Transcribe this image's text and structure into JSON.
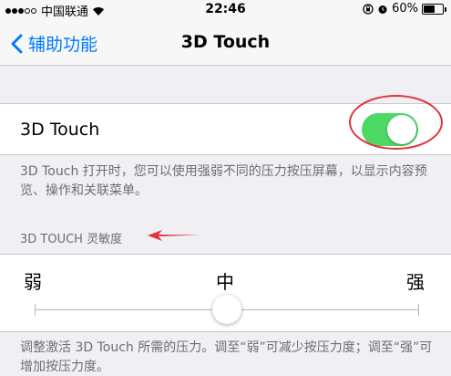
{
  "status_bar": {
    "carrier": "中国联通",
    "time": "22:46",
    "battery": "60%",
    "battery_level": 0.6,
    "signal_strength": 3,
    "signal_total": 5,
    "icons": [
      "signal-dots-icon",
      "wifi-icon",
      "orientation-lock-icon",
      "alarm-icon",
      "battery-icon"
    ]
  },
  "nav": {
    "back_label": "辅助功能",
    "title": "3D Touch"
  },
  "toggle_row": {
    "label": "3D Touch",
    "enabled": true,
    "on_color": "#4cd964"
  },
  "toggle_description": "3D Touch 打开时，您可以使用强弱不同的压力按压屏幕，以显示内容预览、操作和关联菜单。",
  "sensitivity": {
    "header": "3D TOUCH 灵敏度",
    "weak_label": "弱",
    "medium_label": "中",
    "strong_label": "强",
    "value": 0.5,
    "description": "调整激活 3D Touch 所需的压力。调至“弱”可减少按压力度；调至“强”可增加按压力度。"
  },
  "colors": {
    "accent": "#007aff",
    "annotation": "#e3333c",
    "background": "#efeff4",
    "secondary_text": "#6d6d72"
  }
}
